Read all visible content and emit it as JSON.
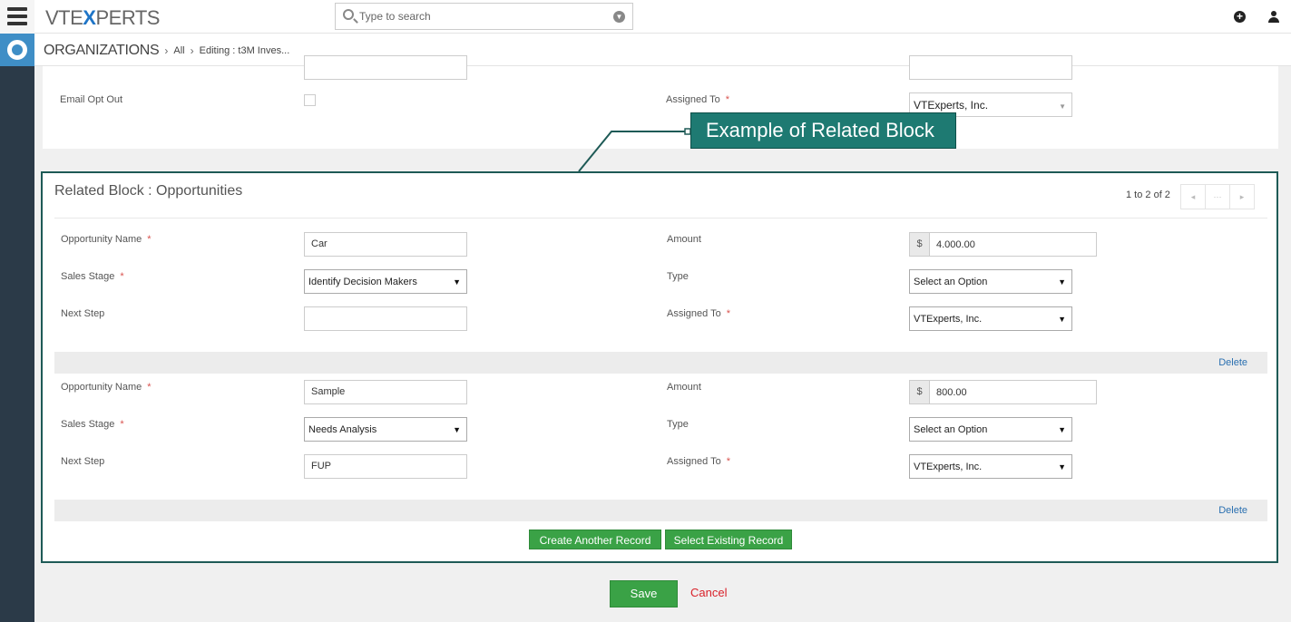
{
  "app": {
    "logo_prefix": "VTE",
    "logo_x": "X",
    "logo_suffix": "PERTS"
  },
  "search": {
    "placeholder": "Type to search"
  },
  "breadcrumb": {
    "module": "ORGANIZATIONS",
    "filter": "All",
    "current": "Editing : t3M Inves..."
  },
  "top_card": {
    "email_opt_out_label": "Email Opt Out",
    "assigned_to_label": "Assigned To",
    "assigned_to_value": "VTExperts, Inc.",
    "required_mark": "*"
  },
  "callout": {
    "text": "Example of Related Block"
  },
  "related_block": {
    "title": "Related Block : Opportunities",
    "pager_text": "1 to 2 of 2",
    "pager_prev": "◂",
    "pager_more": "···",
    "pager_next": "▸",
    "labels": {
      "opportunity_name": "Opportunity Name",
      "sales_stage": "Sales Stage",
      "next_step": "Next Step",
      "amount": "Amount",
      "type": "Type",
      "assigned_to": "Assigned To",
      "required_mark": "*"
    },
    "records": [
      {
        "opportunity_name": "Car",
        "sales_stage": "Identify Decision Makers",
        "next_step": "",
        "currency": "$",
        "amount": "4.000.00",
        "type": "Select an Option",
        "assigned_to": "VTExperts, Inc.",
        "delete_label": "Delete"
      },
      {
        "opportunity_name": "Sample",
        "sales_stage": "Needs Analysis",
        "next_step": "FUP",
        "currency": "$",
        "amount": "800.00",
        "type": "Select an Option",
        "assigned_to": "VTExperts, Inc.",
        "delete_label": "Delete"
      }
    ],
    "create_button": "Create Another Record",
    "select_button": "Select Existing Record"
  },
  "footer": {
    "save_label": "Save",
    "cancel_label": "Cancel"
  },
  "colors": {
    "accent_green": "#3aa246",
    "callout_teal": "#1e7a72",
    "brand_blue": "#1f75c7",
    "cancel_red": "#d9222a",
    "rail_dark": "#2b3a48"
  }
}
